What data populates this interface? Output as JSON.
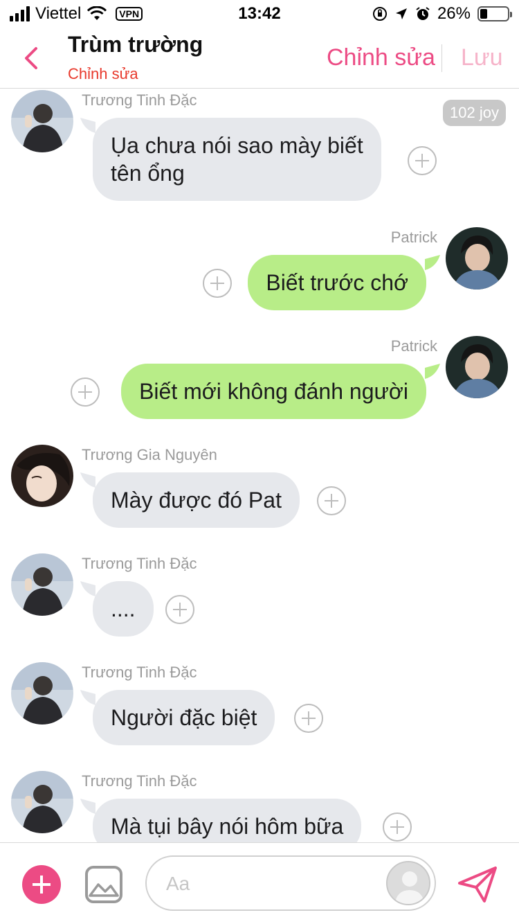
{
  "status_bar": {
    "carrier": "Viettel",
    "vpn": "VPN",
    "time": "13:42",
    "battery": "26%",
    "battery_level": 0.26
  },
  "header": {
    "title": "Trùm trường",
    "subtitle": "Chỉnh sửa",
    "edit_label": "Chỉnh sửa",
    "save_label": "Lưu"
  },
  "badge": "102 joy",
  "messages": [
    {
      "sender": "Trương Tinh Đặc",
      "side": "in",
      "lines": [
        "Ụa chưa nói sao mày biết",
        "tên ổng"
      ]
    },
    {
      "sender": "Patrick",
      "side": "out",
      "lines": [
        "Biết trước chớ"
      ]
    },
    {
      "sender": "Patrick",
      "side": "out",
      "lines": [
        "Biết mới không đánh người"
      ]
    },
    {
      "sender": "Trương Gia Nguyên",
      "side": "in",
      "lines": [
        "Mày được đó Pat"
      ]
    },
    {
      "sender": "Trương Tinh Đặc",
      "side": "in",
      "lines": [
        "...."
      ]
    },
    {
      "sender": "Trương Tinh Đặc",
      "side": "in",
      "lines": [
        "Người đặc biệt"
      ]
    },
    {
      "sender": "Trương Tinh Đặc",
      "side": "in",
      "lines": [
        "Mà tụi bây nói hôm bữa"
      ]
    }
  ],
  "composer": {
    "placeholder": "Aa"
  },
  "colors": {
    "accent": "#ec4b84",
    "subtitle": "#e8392c",
    "incoming_bubble": "#e6e8ec",
    "outgoing_bubble": "#b8ed88"
  }
}
